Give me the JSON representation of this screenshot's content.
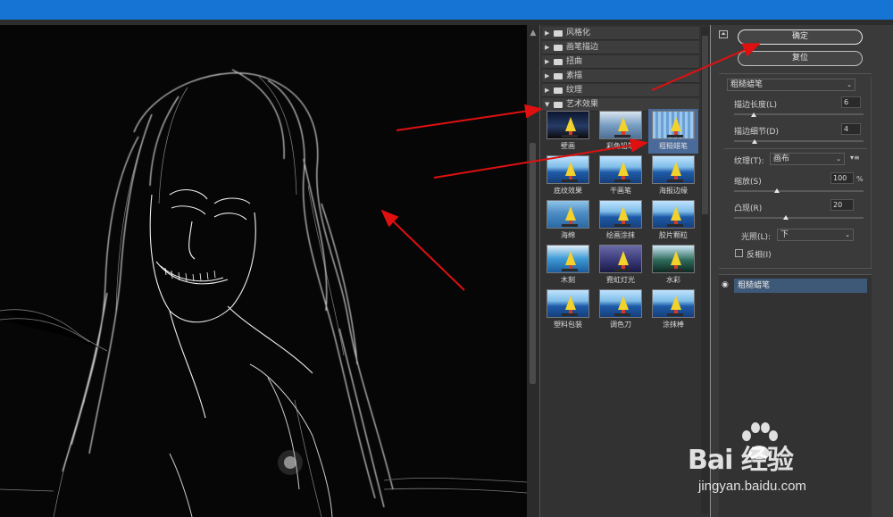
{
  "filter_categories": [
    {
      "label": "风格化",
      "expanded": false
    },
    {
      "label": "画笔描边",
      "expanded": false
    },
    {
      "label": "扭曲",
      "expanded": false
    },
    {
      "label": "素描",
      "expanded": false
    },
    {
      "label": "纹理",
      "expanded": false
    },
    {
      "label": "艺术效果",
      "expanded": true
    }
  ],
  "artistic_filters": [
    {
      "label": "壁画"
    },
    {
      "label": "彩色铅笔"
    },
    {
      "label": "粗糙蜡笔",
      "selected": true
    },
    {
      "label": "底纹效果"
    },
    {
      "label": "干画笔"
    },
    {
      "label": "海报边缘"
    },
    {
      "label": "海绵"
    },
    {
      "label": "绘画涂抹"
    },
    {
      "label": "胶片颗粒"
    },
    {
      "label": "木刻"
    },
    {
      "label": "霓虹灯光"
    },
    {
      "label": "水彩"
    },
    {
      "label": "塑料包装"
    },
    {
      "label": "调色刀"
    },
    {
      "label": "涂抹棒"
    }
  ],
  "settings": {
    "ok_label": "确定",
    "reset_label": "复位",
    "filter_select": "粗糙蜡笔",
    "stroke_length_label": "描边长度(L)",
    "stroke_length_value": "6",
    "stroke_detail_label": "描边细节(D)",
    "stroke_detail_value": "4",
    "texture_label": "纹理(T):",
    "texture_value": "画布",
    "scaling_label": "缩放(S)",
    "scaling_value": "100",
    "scaling_unit": "%",
    "relief_label": "凸现(R)",
    "relief_value": "20",
    "light_label": "光照(L):",
    "light_value": "下",
    "invert_label": "反相(I)",
    "invert_checked": false
  },
  "layers": [
    {
      "label": "粗糙蜡笔",
      "visible": true
    }
  ],
  "watermark": {
    "brand": "Bai 经验",
    "url": "jingyan.baidu.com"
  },
  "colors": {
    "titlebar": "#1574d4",
    "panel": "#3a3a3a",
    "selected_thumb": "#4a6a9a",
    "annotation_arrow": "#e01010"
  }
}
